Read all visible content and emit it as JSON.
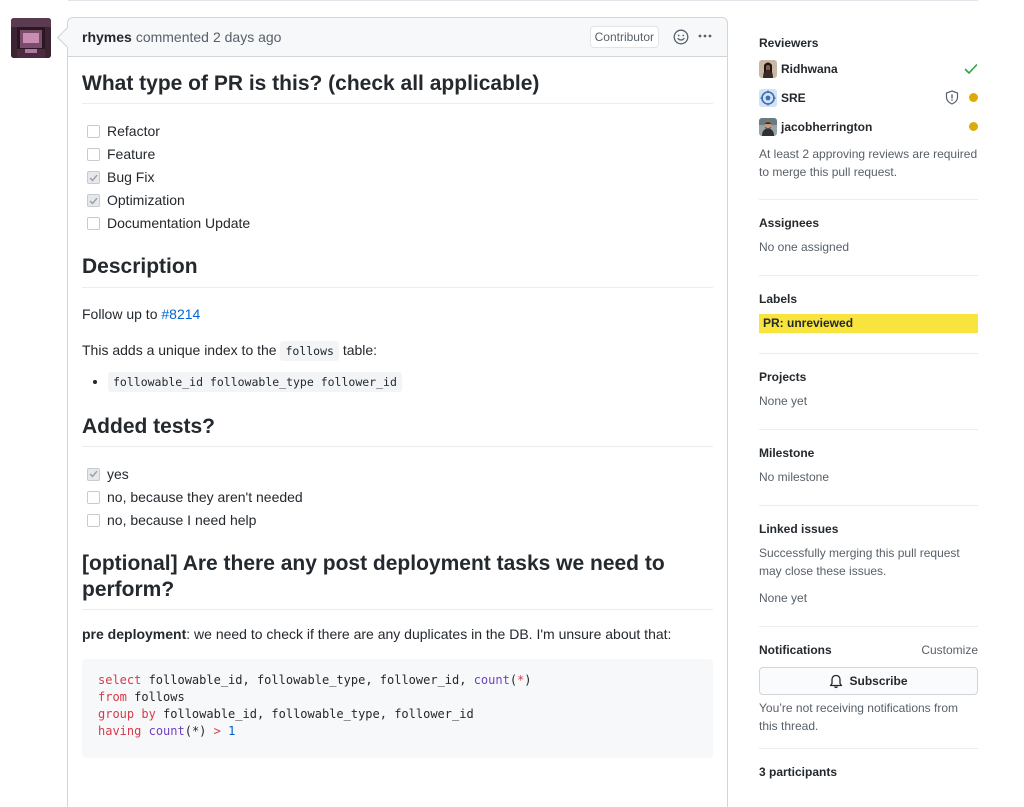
{
  "comment": {
    "author": "rhymes",
    "action": "commented",
    "time": "2 days ago",
    "role_badge": "Contributor",
    "icons": {
      "emoji": "smiley-icon",
      "more": "kebab-horizontal-icon"
    }
  },
  "body": {
    "pr_type": {
      "heading": "What type of PR is this? (check all applicable)",
      "items": [
        {
          "label": "Refactor",
          "checked": false
        },
        {
          "label": "Feature",
          "checked": false
        },
        {
          "label": "Bug Fix",
          "checked": true
        },
        {
          "label": "Optimization",
          "checked": true
        },
        {
          "label": "Documentation Update",
          "checked": false
        }
      ]
    },
    "description": {
      "heading": "Description",
      "follow_up_prefix": "Follow up to ",
      "follow_up_link": "#8214",
      "adds_prefix": "This adds a unique index to the ",
      "adds_code": "follows",
      "adds_suffix": " table:",
      "bullet_code": "followable_id followable_type follower_id"
    },
    "tests": {
      "heading": "Added tests?",
      "items": [
        {
          "label": "yes",
          "checked": true
        },
        {
          "label": "no, because they aren't needed",
          "checked": false
        },
        {
          "label": "no, because I need help",
          "checked": false
        }
      ]
    },
    "post_deploy": {
      "heading": "[optional] Are there any post deployment tasks we need to perform?",
      "pre_label": "pre deployment",
      "pre_text": ": we need to check if there are any duplicates in the DB. I'm unsure about that:",
      "code": {
        "l1_kw": "select",
        "l1_cols": " followable_id, followable_type, follower_id, ",
        "l1_fn": "count",
        "l1_open": "(",
        "l1_star": "*",
        "l1_close": ")",
        "l2_kw": "from",
        "l2_rest": " follows",
        "l3_kw": "group by",
        "l3_rest": " followable_id, followable_type, follower_id",
        "l4_kw": "having",
        "l4_space": " ",
        "l4_fn": "count",
        "l4_args": "(*) ",
        "l4_op": ">",
        "l4_sp2": " ",
        "l4_num": "1"
      }
    }
  },
  "sidebar": {
    "reviewers": {
      "title": "Reviewers",
      "items": [
        {
          "name": "Ridhwana",
          "status": "approved"
        },
        {
          "name": "SRE",
          "status": "pending",
          "code_owner": true
        },
        {
          "name": "jacobherrington",
          "status": "pending"
        }
      ],
      "note": "At least 2 approving reviews are required to merge this pull request."
    },
    "assignees": {
      "title": "Assignees",
      "value": "No one assigned"
    },
    "labels": {
      "title": "Labels",
      "items": [
        "PR: unreviewed"
      ],
      "label_color": "#f9e43d"
    },
    "projects": {
      "title": "Projects",
      "value": "None yet"
    },
    "milestone": {
      "title": "Milestone",
      "value": "No milestone"
    },
    "linked_issues": {
      "title": "Linked issues",
      "note": "Successfully merging this pull request may close these issues.",
      "value": "None yet"
    },
    "notifications": {
      "title": "Notifications",
      "customize": "Customize",
      "subscribe": "Subscribe",
      "note": "You’re not receiving notifications from this thread."
    },
    "participants": {
      "title": "3 participants"
    }
  },
  "colors": {
    "link": "#0366d6",
    "approved": "#28a745",
    "pending": "#dbab09",
    "label": "#f9e43d"
  }
}
